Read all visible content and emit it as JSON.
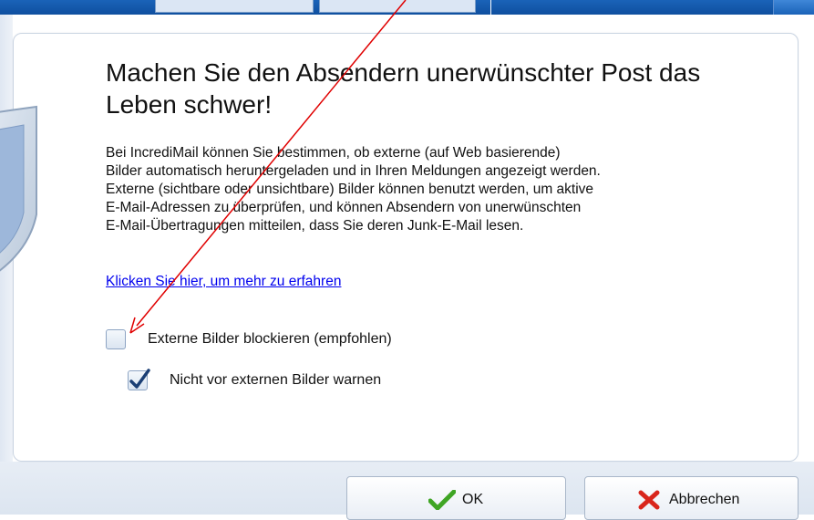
{
  "dialog": {
    "heading": "Machen Sie den Absendern unerwünschter Post das Leben schwer!",
    "description": "Bei IncrediMail können Sie bestimmen, ob externe (auf Web basierende)\nBilder automatisch heruntergeladen und in Ihren Meldungen angezeigt werden.\nExterne (sichtbare oder unsichtbare) Bilder können benutzt werden, um aktive\nE-Mail-Adressen zu überprüfen, und können Absendern von unerwünschten\nE-Mail-Übertragungen mitteilen, dass Sie deren Junk-E-Mail lesen.",
    "learn_more_link": "Klicken Sie hier, um mehr zu erfahren",
    "options": [
      {
        "label": "Externe Bilder blockieren (empfohlen)",
        "checked": false
      },
      {
        "label": "Nicht vor externen Bilder warnen",
        "checked": true
      }
    ]
  },
  "buttons": {
    "ok": "OK",
    "cancel": "Abbrechen"
  },
  "icons": {
    "shield": "shield-icon",
    "ok": "green-check-icon",
    "cancel": "red-x-icon",
    "checkmark": "checkmark-icon"
  },
  "colors": {
    "title_bar": "#1a63b8",
    "link": "#0000ee",
    "annotation_arrow": "#e00000",
    "ok_icon": "#3fa524",
    "cancel_icon": "#d9261c"
  }
}
